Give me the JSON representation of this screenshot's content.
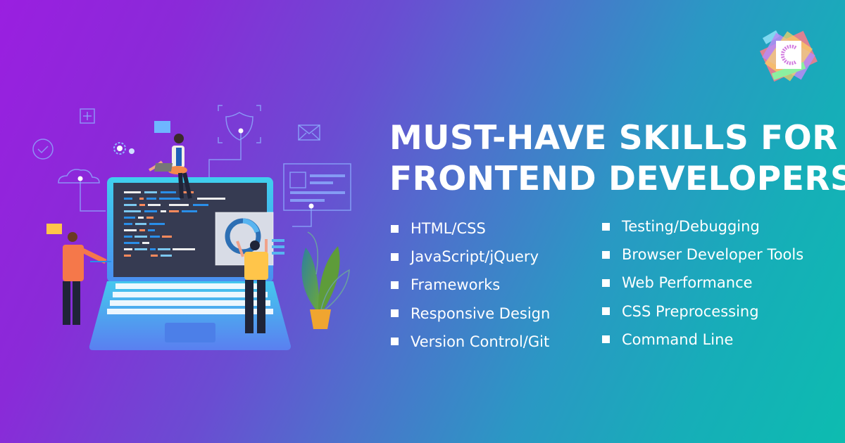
{
  "brand": {
    "logo_icon": "colorful-c-logo-icon",
    "colors": {
      "gradient_start": "#9a1fe0",
      "gradient_mid": "#4d72cc",
      "gradient_end": "#0dbcb0",
      "text": "#ffffff"
    }
  },
  "heading": {
    "line1": "MUST-HAVE SKILLS FOR",
    "line2": "FRONTEND DEVELOPERS"
  },
  "skills": {
    "column1": [
      {
        "label": "HTML/CSS"
      },
      {
        "label": "JavaScript/jQuery"
      },
      {
        "label": "Frameworks"
      },
      {
        "label": "Responsive Design"
      },
      {
        "label": "Version Control/Git"
      }
    ],
    "column2": [
      {
        "label": "Testing/Debugging"
      },
      {
        "label": "Browser Developer Tools"
      },
      {
        "label": "Web Performance"
      },
      {
        "label": "CSS Preprocessing"
      },
      {
        "label": "Command Line"
      }
    ]
  },
  "illustration": {
    "description": "developers-working-on-laptop",
    "icons": [
      "plus-icon",
      "checkmark-circle-icon",
      "gear-icon",
      "cloud-icon",
      "chat-bubble-icon",
      "shield-icon",
      "envelope-icon",
      "web-card-icon",
      "donut-chart-icon",
      "plant-icon",
      "laptop-icon"
    ]
  }
}
